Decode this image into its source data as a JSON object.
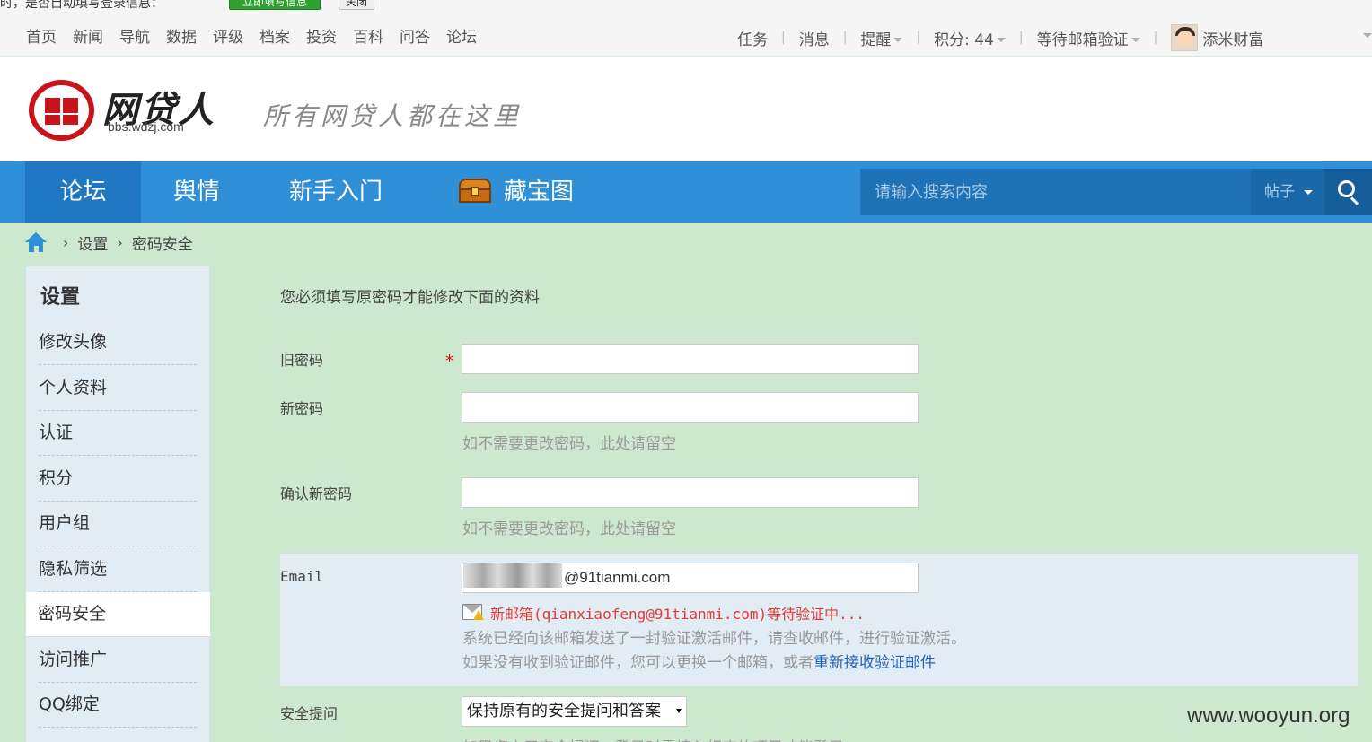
{
  "notice": {
    "text": "时，是否自动填写登录信息：",
    "btn_confirm": "立即填写信息",
    "btn_close": "关闭"
  },
  "topnav": [
    "首页",
    "新闻",
    "导航",
    "数据",
    "评级",
    "档案",
    "投资",
    "百科",
    "问答",
    "论坛"
  ],
  "topright": {
    "tasks": "任务",
    "messages": "消息",
    "reminders": "提醒",
    "points": "积分: 44",
    "email_status": "等待邮箱验证",
    "username": "添米财富"
  },
  "header": {
    "logo_name": "网贷人",
    "logo_url": "bbs.wdzj.com",
    "slogan": "所有网贷人都在这里"
  },
  "mainnav": {
    "items": [
      "论坛",
      "舆情",
      "新手入门",
      "藏宝图"
    ],
    "search_placeholder": "请输入搜索内容",
    "search_type": "帖子"
  },
  "breadcrumb": {
    "level1": "设置",
    "level2": "密码安全"
  },
  "sidebar": {
    "title": "设置",
    "items": [
      "修改头像",
      "个人资料",
      "认证",
      "积分",
      "用户组",
      "隐私筛选",
      "密码安全",
      "访问推广",
      "QQ绑定"
    ]
  },
  "form": {
    "hint": "您必须填写原密码才能修改下面的资料",
    "old_password_label": "旧密码",
    "required_mark": "*",
    "new_password_label": "新密码",
    "new_password_tip": "如不需要更改密码，此处请留空",
    "confirm_password_label": "确认新密码",
    "confirm_password_tip": "如不需要更改密码，此处请留空",
    "email_label": "Email",
    "email_value": "@91tianmi.com",
    "email_pending": "新邮箱(qianxiaofeng@91tianmi.com)等待验证中...",
    "email_sent": "系统已经向该邮箱发送了一封验证激活邮件，请查收邮件，进行验证激活。",
    "email_resend_prefix": "如果没有收到验证邮件，您可以更换一个邮箱，或者",
    "email_resend_link": "重新接收验证邮件",
    "security_question_label": "安全提问",
    "security_question_value": "保持原有的安全提问和答案",
    "security_question_tip": "如果您启用安全提问，登录时需填入相应的项目才能登录"
  },
  "watermark": "www.wooyun.org"
}
